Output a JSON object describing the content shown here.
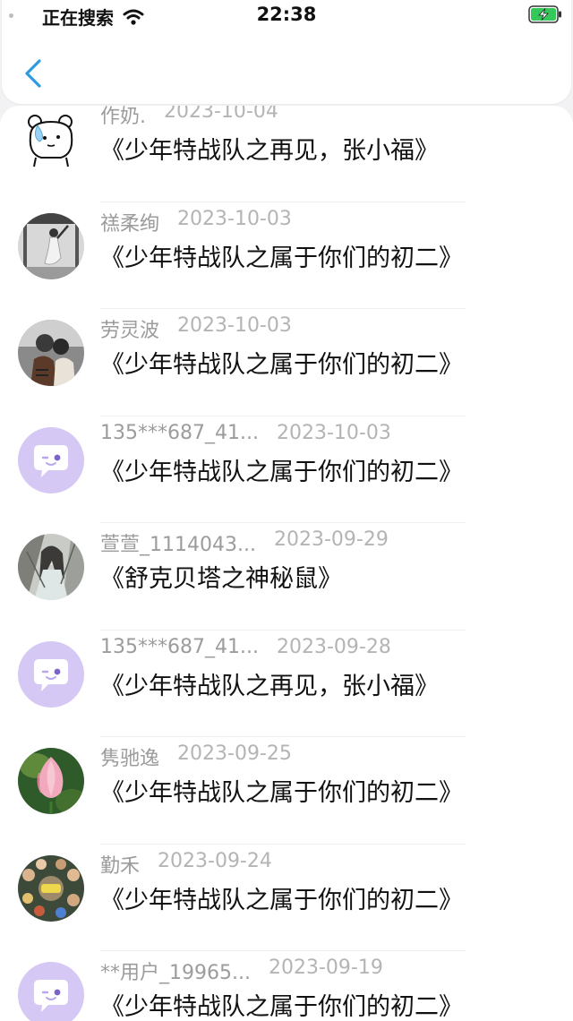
{
  "status_bar": {
    "carrier_text": "正在搜索",
    "time": "22:38",
    "wifi_icon": "wifi-icon",
    "battery_icon": "battery-charging-icon",
    "battery_color": "#34c759"
  },
  "nav": {
    "back_icon": "chevron-left-icon",
    "accent_color": "#2f9bde"
  },
  "list": [
    {
      "user": "作奶.",
      "date": "2023-10-04",
      "title": "《少年特战队之再见，张小福》",
      "avatar": "bear-sticker"
    },
    {
      "user": "禚柔绚",
      "date": "2023-10-03",
      "title": "《少年特战队之属于你们的初二》",
      "avatar": "photo-gray"
    },
    {
      "user": "劳灵波",
      "date": "2023-10-03",
      "title": "《少年特战队之属于你们的初二》",
      "avatar": "photo-couple"
    },
    {
      "user": "135***687_41...",
      "date": "2023-10-03",
      "title": "《少年特战队之属于你们的初二》",
      "avatar": "default-purple"
    },
    {
      "user": "萱萱_1114043...",
      "date": "2023-09-29",
      "title": "《舒克贝塔之神秘鼠》",
      "avatar": "photo-anime"
    },
    {
      "user": "135***687_41...",
      "date": "2023-09-28",
      "title": "《少年特战队之再见，张小福》",
      "avatar": "default-purple"
    },
    {
      "user": "隽驰逸",
      "date": "2023-09-25",
      "title": "《少年特战队之属于你们的初二》",
      "avatar": "photo-lotus"
    },
    {
      "user": "勤禾",
      "date": "2023-09-24",
      "title": "《少年特战队之属于你们的初二》",
      "avatar": "photo-yes"
    },
    {
      "user": "**用户_19965...",
      "date": "2023-09-19",
      "title": "《少年特战队之属于你们的初二》",
      "avatar": "default-purple"
    }
  ]
}
